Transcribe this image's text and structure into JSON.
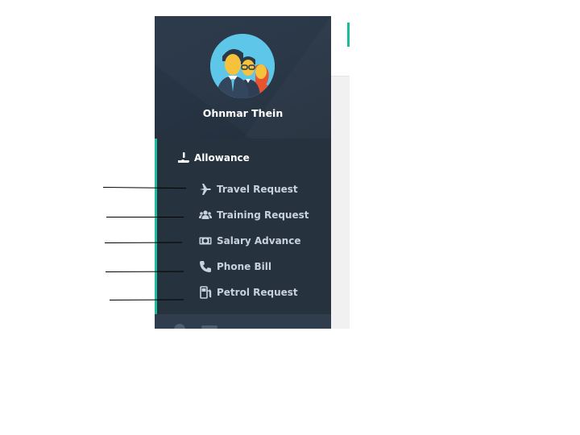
{
  "user": {
    "name": "Ohnmar Thein",
    "avatar_icon": "team-avatar-icon"
  },
  "menu": {
    "section": {
      "label": "Allowance",
      "icon": "hand-money-icon"
    },
    "items": [
      {
        "label": "Travel Request",
        "icon": "plane-icon"
      },
      {
        "label": "Training Request",
        "icon": "users-icon"
      },
      {
        "label": "Salary Advance",
        "icon": "cash-icon"
      },
      {
        "label": "Phone Bill",
        "icon": "phone-icon"
      },
      {
        "label": "Petrol Request",
        "icon": "gas-pump-icon"
      }
    ]
  },
  "colors": {
    "sidebar": "#2a3848",
    "menu": "#26333f",
    "accent": "#1abc9c",
    "menu_text": "#c9d2dc",
    "avatar_bg": "#5ec6e8"
  }
}
